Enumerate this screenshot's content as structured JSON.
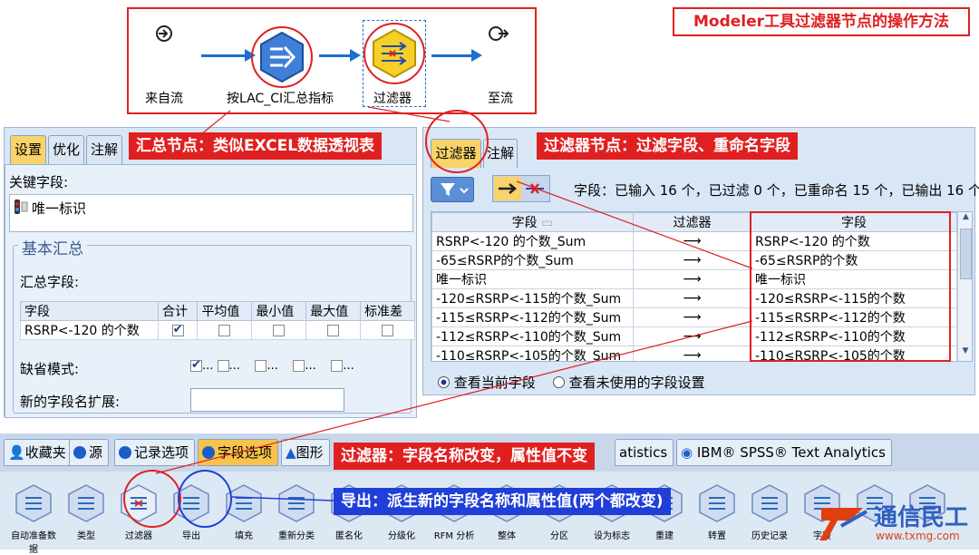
{
  "title": "Modeler工具过滤器节点的操作方法",
  "stream": {
    "nodes": [
      {
        "id": "source",
        "label": "来自流",
        "icon": "stream-in-icon"
      },
      {
        "id": "aggregate",
        "label": "按LAC_CI汇总指标",
        "icon": "aggregate-icon"
      },
      {
        "id": "filter",
        "label": "过滤器",
        "icon": "filter-icon"
      },
      {
        "id": "sink",
        "label": "至流",
        "icon": "stream-out-icon"
      }
    ]
  },
  "agg_dialog": {
    "tabs": [
      "设置",
      "优化",
      "注解"
    ],
    "callout": "汇总节点：类似EXCEL数据透视表",
    "key_fields_label": "关键字段:",
    "key_field": "唯一标识",
    "section_title": "基本汇总",
    "agg_fields_label": "汇总字段:",
    "columns": [
      "字段",
      "合计",
      "平均值",
      "最小值",
      "最大值",
      "标准差"
    ],
    "rows": [
      {
        "field": "RSRP<-120 的个数",
        "checks": [
          true,
          false,
          false,
          false,
          false
        ]
      }
    ],
    "default_mode_label": "缺省模式:",
    "default_mode_checks": [
      true,
      false,
      false,
      false,
      false
    ],
    "ellipsis": "...",
    "new_suffix_label": "新的字段名扩展:",
    "new_suffix_value": ""
  },
  "filter_dialog": {
    "tabs": [
      "过滤器",
      "注解"
    ],
    "callout": "过滤器节点：过滤字段、重命名字段",
    "summary": "字段：已输入 16 个，已过滤 0 个，已重命名 15 个，已输出 16 个",
    "columns": [
      "字段",
      "过滤器",
      "字段"
    ],
    "rows": [
      {
        "in": "RSRP<-120 的个数_Sum",
        "out": "RSRP<-120 的个数"
      },
      {
        "in": "-65≤RSRP的个数_Sum",
        "out": "-65≤RSRP的个数"
      },
      {
        "in": "唯一标识",
        "out": "唯一标识"
      },
      {
        "in": "-120≤RSRP<-115的个数_Sum",
        "out": "-120≤RSRP<-115的个数"
      },
      {
        "in": "-115≤RSRP<-112的个数_Sum",
        "out": "-115≤RSRP<-112的个数"
      },
      {
        "in": "-112≤RSRP<-110的个数_Sum",
        "out": "-112≤RSRP<-110的个数"
      },
      {
        "in": "-110≤RSRP<-105的个数_Sum",
        "out": "-110≤RSRP<-105的个数"
      }
    ],
    "radio_current": "查看当前字段",
    "radio_unused": "查看未使用的字段设置"
  },
  "palette_tabs": [
    {
      "label": "收藏夹",
      "icon": "person-icon"
    },
    {
      "label": "源",
      "icon": "dot-icon"
    },
    {
      "label": "记录选项",
      "icon": "dot-icon"
    },
    {
      "label": "字段选项",
      "icon": "dot-icon",
      "active": true
    },
    {
      "label": "图形",
      "icon": "triangle-icon"
    },
    {
      "label": "atistics",
      "icon": ""
    },
    {
      "label": "IBM® SPSS® Text Analytics",
      "icon": "spss-icon"
    }
  ],
  "palette_callout": "过滤器：字段名称改变，属性值不变",
  "export_callout": "导出：派生新的字段名称和属性值(两个都改变)",
  "palette_items": [
    "自动准备数据",
    "类型",
    "过滤器",
    "导出",
    "填充",
    "重新分类",
    "匿名化",
    "分级化",
    "RFM 分析",
    "整体",
    "分区",
    "设为标志",
    "重建",
    "转置",
    "历史记录",
    "字段",
    "",
    ""
  ],
  "watermark": "通信民工",
  "watermark_url": "www.txmg.com",
  "colors": {
    "red": "#e02020",
    "blue": "#1f3fd8",
    "accent": "#f7d36a"
  }
}
